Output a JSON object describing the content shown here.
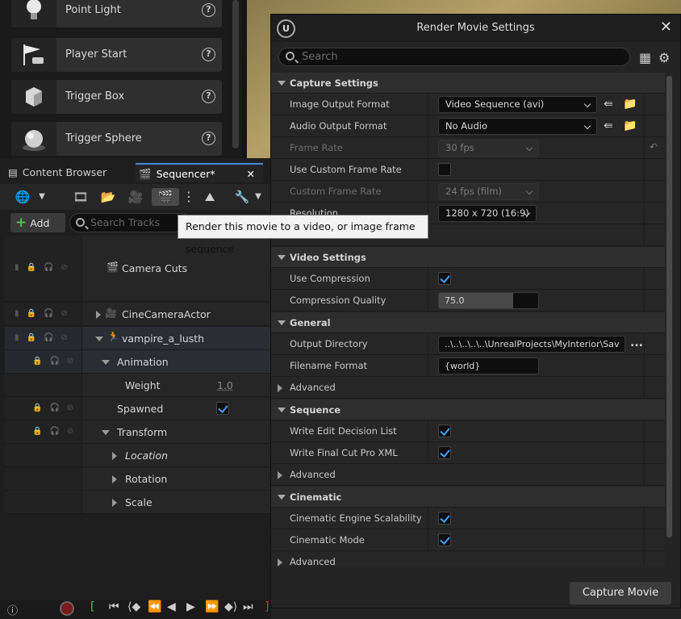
{
  "place_actors": {
    "items": [
      {
        "label": "Point Light",
        "icon": "lightbulb-icon"
      },
      {
        "label": "Player Start",
        "icon": "flag-icon"
      },
      {
        "label": "Trigger Box",
        "icon": "cube-icon"
      },
      {
        "label": "Trigger Sphere",
        "icon": "sphere-icon"
      }
    ]
  },
  "tabs": {
    "content_browser": "Content Browser",
    "sequencer": "Sequencer*"
  },
  "sequencer": {
    "add_label": "Add",
    "search_placeholder": "Search Tracks",
    "tooltip": "Render this movie to a video, or image frame sequence",
    "tracks": {
      "camera_cuts": "Camera Cuts",
      "cine_camera": "CineCameraActor",
      "vampire": "vampire_a_lusth",
      "animation": "Animation",
      "weight_label": "Weight",
      "weight_value": "1.0",
      "spawned": "Spawned",
      "transform": "Transform",
      "location": "Location",
      "rotation": "Rotation",
      "scale": "Scale"
    },
    "spawned_checked": true
  },
  "dialog": {
    "title": "Render Movie Settings",
    "search_placeholder": "Search",
    "capture_button": "Capture Movie",
    "categories": {
      "capture": "Capture Settings",
      "video": "Video Settings",
      "general": "General",
      "sequence": "Sequence",
      "cinematic": "Cinematic"
    },
    "rows": {
      "image_output_format": {
        "label": "Image Output Format",
        "value": "Video Sequence (avi)"
      },
      "audio_output_format": {
        "label": "Audio Output Format",
        "value": "No Audio"
      },
      "frame_rate": {
        "label": "Frame Rate",
        "value": "30 fps"
      },
      "use_custom_frame_rate": {
        "label": "Use Custom Frame Rate",
        "checked": false
      },
      "custom_frame_rate": {
        "label": "Custom Frame Rate",
        "value": "24 fps (film)"
      },
      "resolution": {
        "label": "Resolution",
        "value": "1280 x 720 (16:9)"
      },
      "use_compression": {
        "label": "Use Compression",
        "checked": true
      },
      "compression_quality": {
        "label": "Compression Quality",
        "value": "75.0",
        "fill_fraction": 0.75
      },
      "output_directory": {
        "label": "Output Directory",
        "value": "..\\..\\..\\..\\..\\UnrealProjects\\MyInterior\\Sav",
        "more": "..."
      },
      "filename_format": {
        "label": "Filename Format",
        "value": "{world}"
      },
      "advanced_general": {
        "label": "Advanced"
      },
      "write_edl": {
        "label": "Write Edit Decision List",
        "checked": true
      },
      "write_fcp": {
        "label": "Write Final Cut Pro XML",
        "checked": true
      },
      "advanced_sequence": {
        "label": "Advanced"
      },
      "engine_scalability": {
        "label": "Cinematic Engine Scalability",
        "checked": true
      },
      "cinematic_mode": {
        "label": "Cinematic Mode",
        "checked": true
      },
      "advanced_cinematic": {
        "label": "Advanced"
      }
    }
  },
  "colors": {
    "accent": "#3f8ee0",
    "checkmark": "#3f9fff",
    "add_plus": "#4cc24c"
  }
}
